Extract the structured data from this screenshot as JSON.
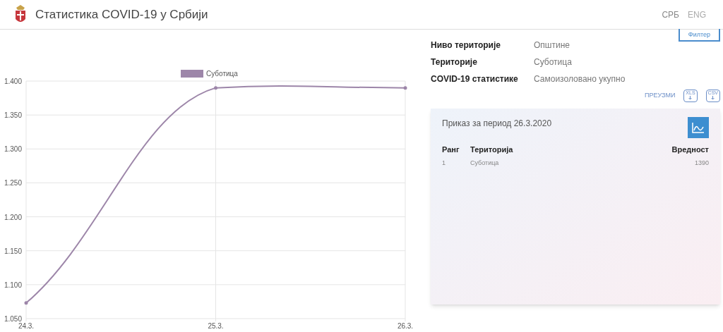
{
  "header": {
    "title": "Статистика COVID-19 у Србији",
    "languages": [
      {
        "label": "СРБ",
        "selected": true
      },
      {
        "label": "ENG",
        "selected": false
      }
    ]
  },
  "filter_button": "Филтер",
  "chart_data": {
    "type": "line",
    "categories": [
      "24.3.",
      "25.3.",
      "26.3."
    ],
    "series": [
      {
        "name": "Суботица",
        "color": "#9d86a9",
        "values": [
          1073,
          1390,
          1390
        ]
      }
    ],
    "ylim": [
      1050,
      1400
    ],
    "grid": true,
    "yticks": [
      {
        "value": 1050,
        "label": "1.050"
      },
      {
        "value": 1100,
        "label": "1.100"
      },
      {
        "value": 1150,
        "label": "1.150"
      },
      {
        "value": 1200,
        "label": "1.200"
      },
      {
        "value": 1250,
        "label": "1.250"
      },
      {
        "value": 1300,
        "label": "1.300"
      },
      {
        "value": 1350,
        "label": "1.350"
      },
      {
        "value": 1400,
        "label": "1.400"
      }
    ]
  },
  "filters": [
    {
      "label": "Ниво територије",
      "value": "Општине"
    },
    {
      "label": "Територије",
      "value": "Суботица"
    },
    {
      "label": "COVID-19 статистике",
      "value": "Самоизоловано укупно"
    }
  ],
  "download": {
    "label": "ПРЕУЗМИ",
    "formats": [
      "XLS",
      "CSV"
    ]
  },
  "summary": {
    "title": "Приказ за период 26.3.2020",
    "columns": [
      "Ранг",
      "Територија",
      "Вредност"
    ],
    "rows": [
      [
        "1",
        "Суботица",
        "1390"
      ]
    ]
  }
}
